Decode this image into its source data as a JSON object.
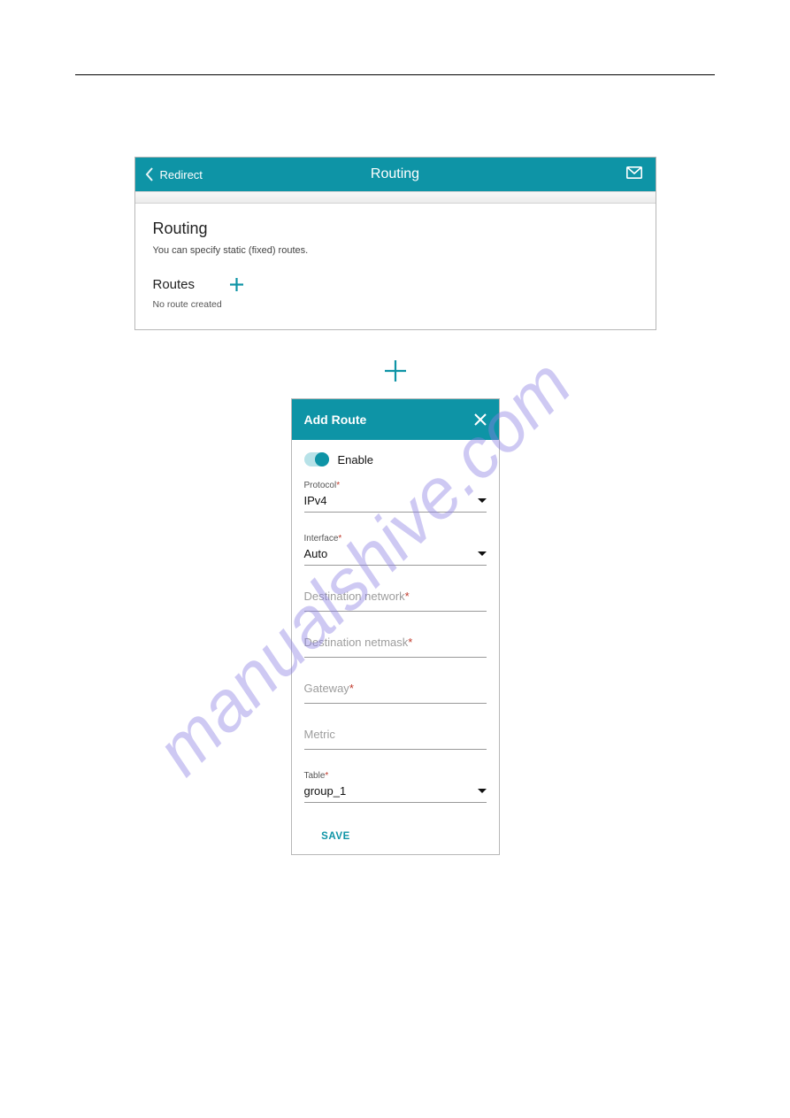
{
  "panel1": {
    "back_label": "Redirect",
    "title": "Routing",
    "section_title": "Routing",
    "section_desc": "You can specify static (fixed) routes.",
    "routes_label": "Routes",
    "no_route": "No route created"
  },
  "dialog": {
    "title": "Add Route",
    "enable_label": "Enable",
    "protocol_label": "Protocol",
    "protocol_value": "IPv4",
    "interface_label": "Interface",
    "interface_value": "Auto",
    "dest_network_ph": "Destination network",
    "dest_netmask_ph": "Destination netmask",
    "gateway_ph": "Gateway",
    "metric_ph": "Metric",
    "table_label": "Table",
    "table_value": "group_1",
    "save_label": "SAVE"
  },
  "watermark_text": "manualshive.com"
}
